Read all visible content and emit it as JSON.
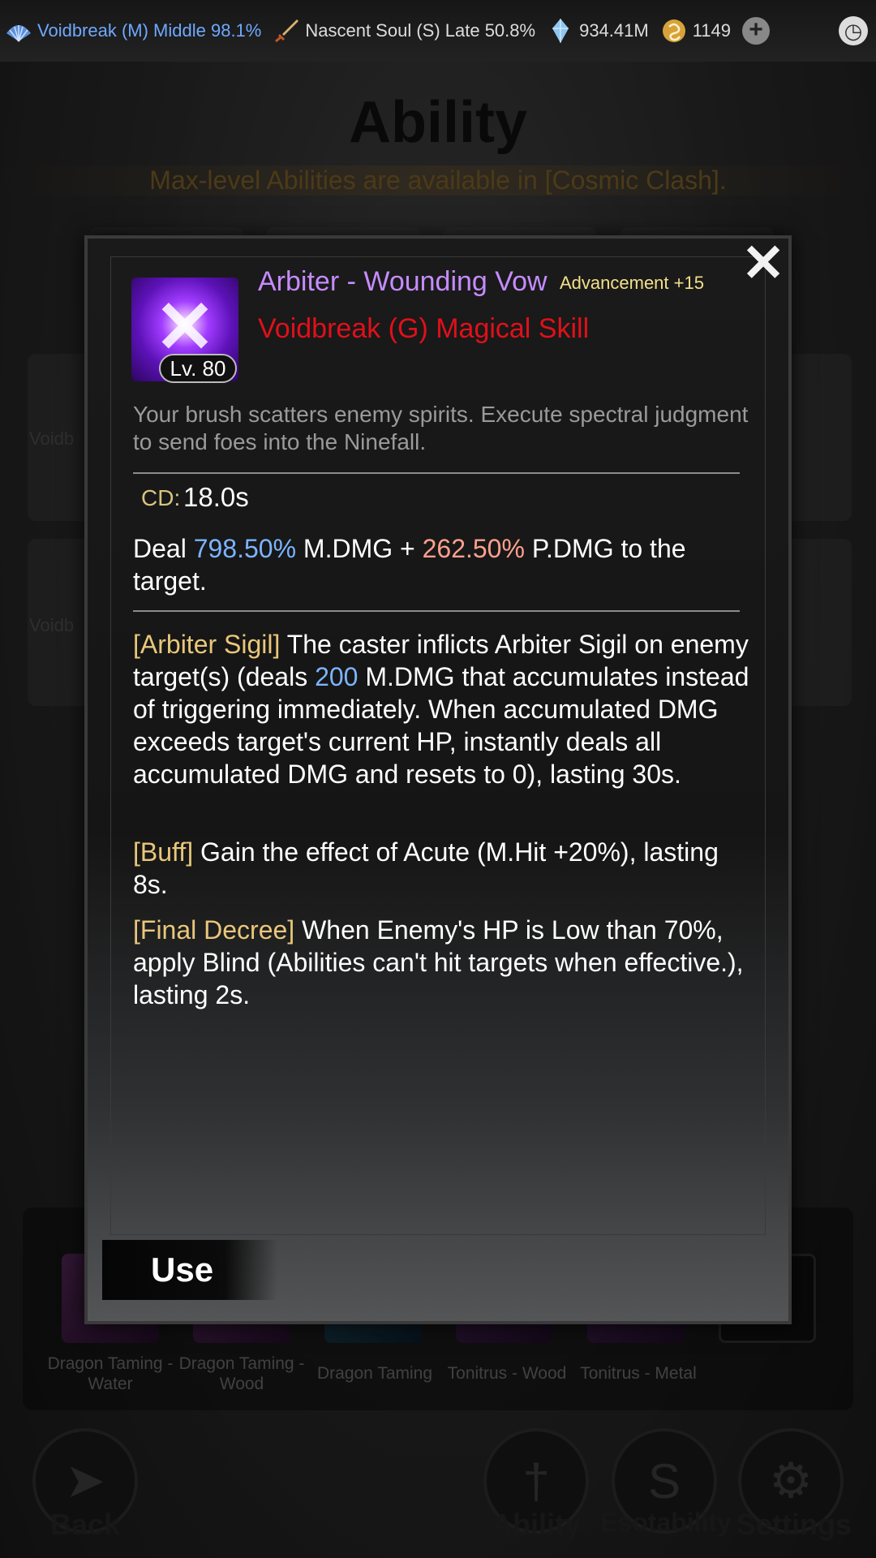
{
  "topbar": {
    "realm1": "Voidbreak (M) Middle 98.1%",
    "realm2": "Nascent Soul (S) Late 50.8%",
    "spirit_stones": "934.41M",
    "jade": "1149",
    "plus": "+",
    "clock": "◷"
  },
  "page": {
    "title": "Ability",
    "notice": "Max-level Abilities are available in [Cosmic Clash]."
  },
  "background": {
    "row_label_1": "Voidb",
    "row_label_2": "Voidb"
  },
  "tray": {
    "items": [
      {
        "label": "Dragon Taming - Water"
      },
      {
        "label": "Dragon Taming - Wood"
      },
      {
        "label": "Dragon Taming"
      },
      {
        "label": "Tonitrus - Wood"
      },
      {
        "label": "Tonitrus - Metal"
      }
    ]
  },
  "nav": {
    "back": "Back",
    "ability": "Ability",
    "esotability": "Esotability",
    "settings": "Settings"
  },
  "modal": {
    "close": "✕",
    "level": "Lv. 80",
    "name": "Arbiter - Wounding Vow",
    "advancement": "Advancement +15",
    "type": "Voidbreak (G) Magical Skill",
    "flavor": "Your brush scatters enemy spirits. Execute spectral judgment to send foes into the Ninefall.",
    "cd_label": "CD:",
    "cd_value": "18.0s",
    "deal": {
      "pre": "Deal ",
      "mdmg": "798.50%",
      "mid": " M.DMG + ",
      "pdmg": "262.50%",
      "post": " P.DMG to the target."
    },
    "sigil": {
      "tag": "[Arbiter Sigil]",
      "pre": " The caster inflicts Arbiter Sigil on enemy target(s) (deals ",
      "value": "200",
      "post": " M.DMG that accumulates instead of triggering immediately. When accumulated DMG exceeds target's current HP, instantly deals all accumulated DMG and resets to 0), lasting 30s."
    },
    "buff": {
      "tag": "[Buff]",
      "text": " Gain the effect of Acute (M.Hit +20%), lasting 8s."
    },
    "decree": {
      "tag": "[Final Decree]",
      "text": " When Enemy's HP is Low than 70%, apply Blind (Abilities can't hit targets when effective.), lasting 2s."
    },
    "use_label": "Use"
  }
}
